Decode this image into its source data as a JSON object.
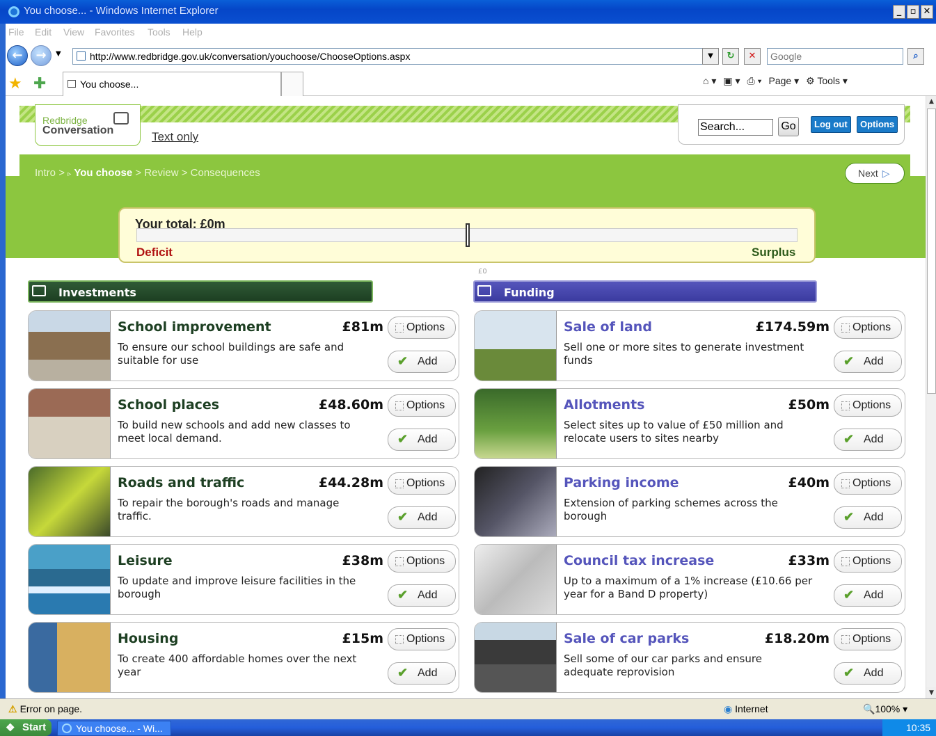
{
  "window": {
    "title": "You choose... - Windows Internet Explorer"
  },
  "menu": [
    "File",
    "Edit",
    "View",
    "Favorites",
    "Tools",
    "Help"
  ],
  "address": {
    "url": "http://www.redbridge.gov.uk/conversation/youchoose/ChooseOptions.aspx",
    "search_placeholder": "Google"
  },
  "tab": {
    "label": "You choose..."
  },
  "commandbar": {
    "page": "Page",
    "tools": "Tools"
  },
  "site": {
    "logo_line1": "Redbridge",
    "logo_line2": "Conversation",
    "text_only": "Text only",
    "search_value": "Search...",
    "go": "Go",
    "logout": "Log out",
    "options": "Options",
    "next": "Next"
  },
  "breadcrumb": {
    "intro": "Intro",
    "sep": ">",
    "current": "You choose",
    "review": "Review",
    "consequences": "Consequences"
  },
  "total": {
    "label": "Your total: £0m",
    "zero": "£0",
    "deficit": "Deficit",
    "surplus": "Surplus",
    "level": 0.5
  },
  "investments": {
    "title": "Investments",
    "items": [
      {
        "name": "School improvement",
        "amount": "£81m",
        "desc": "To ensure our school buildings are safe and suitable for use"
      },
      {
        "name": "School places",
        "amount": "£48.60m",
        "desc": "To build new schools and add new classes to meet local demand."
      },
      {
        "name": "Roads and traffic",
        "amount": "£44.28m",
        "desc": "To repair the borough's roads and manage traffic."
      },
      {
        "name": "Leisure",
        "amount": "£38m",
        "desc": "To update and improve leisure facilities in the borough"
      },
      {
        "name": "Housing",
        "amount": "£15m",
        "desc": "To create 400 affordable homes over the next year"
      }
    ]
  },
  "funding": {
    "title": "Funding",
    "items": [
      {
        "name": "Sale of land",
        "amount": "£174.59m",
        "desc": "Sell one or more sites to generate investment funds"
      },
      {
        "name": "Allotments",
        "amount": "£50m",
        "desc": "Select sites up to value of £50 million and relocate users to sites nearby"
      },
      {
        "name": "Parking income",
        "amount": "£40m",
        "desc": "Extension of parking schemes across the borough"
      },
      {
        "name": "Council tax increase",
        "amount": "£33m",
        "desc": "Up to a maximum of a 1% increase (£10.66 per year for a Band D property)"
      },
      {
        "name": "Sale of car parks",
        "amount": "£18.20m",
        "desc": "Sell some of our car parks and ensure adequate reprovision"
      }
    ]
  },
  "card_buttons": {
    "options": "Options",
    "add": "Add"
  },
  "statusbar": {
    "error": "Error on page.",
    "zone": "Internet",
    "zoom": "100%"
  },
  "taskbar": {
    "start": "Start",
    "item": "You choose... - Wi...",
    "time": "10:35"
  }
}
